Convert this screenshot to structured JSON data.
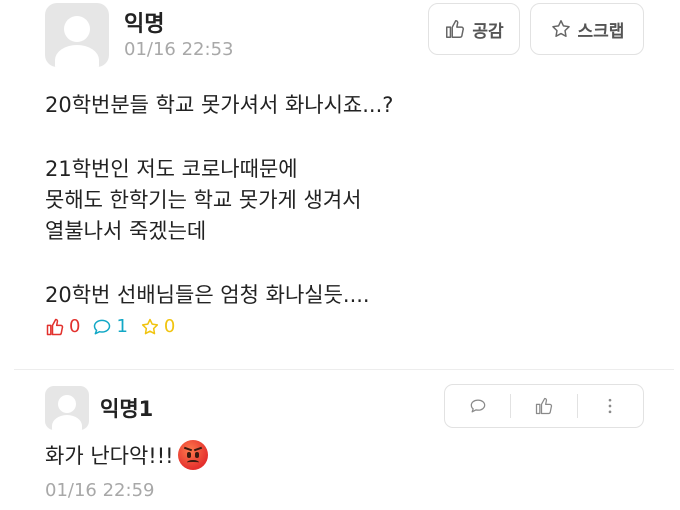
{
  "post": {
    "author": "익명",
    "time": "01/16 22:53",
    "like_button": "공감",
    "scrap_button": "스크랩",
    "lines": [
      "20학번분들 학교 못가셔서 화나시죠...?",
      "21학번인 저도 코로나때문에",
      "못해도 한학기는 학교 못가게 생겨서",
      "열불나서 죽겠는데",
      "20학번 선배님들은 엄청 화나실듯...."
    ],
    "stats": {
      "likes": "0",
      "comments": "1",
      "scraps": "0"
    }
  },
  "comment": {
    "author": "익명1",
    "text": "화가 난다악!!!",
    "emoji": "angry-face-emoji",
    "time": "01/16 22:59"
  },
  "colors": {
    "like": "#e2312d",
    "comment": "#12a8c6",
    "scrap": "#f1c40f",
    "muted": "#a8a8a8"
  }
}
